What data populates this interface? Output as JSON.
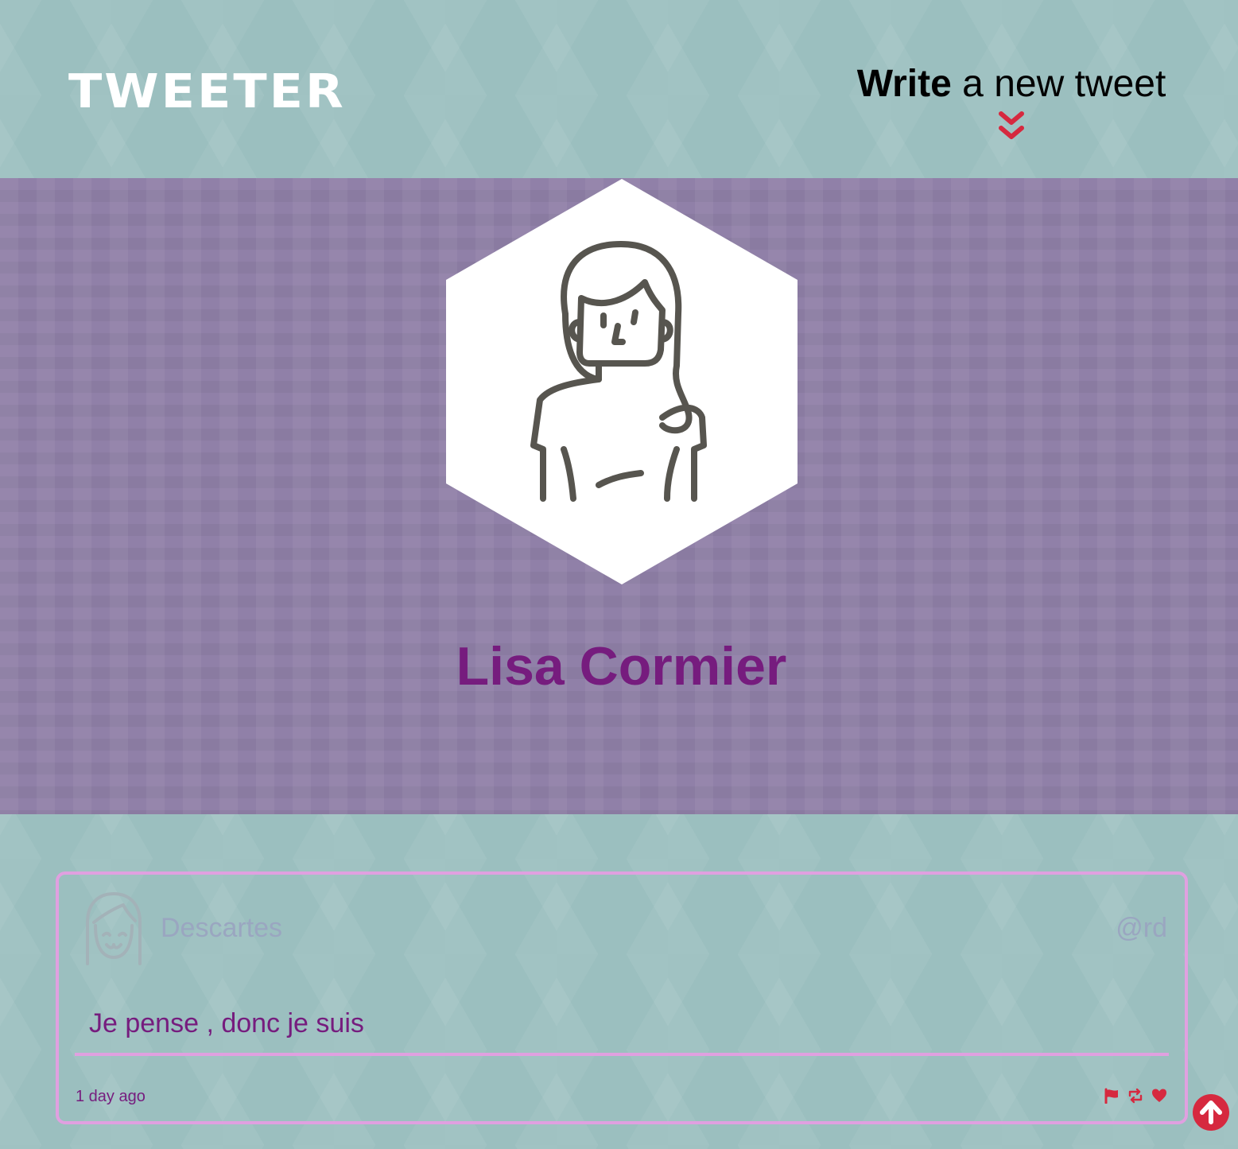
{
  "nav": {
    "brand": "TWEETER",
    "compose_bold": "Write",
    "compose_rest": " a new tweet",
    "compose_icon": "double-chevron-down-icon"
  },
  "profile": {
    "name": "Lisa Cormier",
    "avatar_icon": "woman-avatar-icon"
  },
  "tweets": [
    {
      "author": "Descartes",
      "handle": "@rd",
      "content": "Je pense , donc je suis",
      "time": "1 day ago",
      "avatar_icon": "smiling-face-avatar-icon",
      "actions": [
        "flag-icon",
        "retweet-icon",
        "heart-icon"
      ]
    }
  ],
  "scroll_top_icon": "arrow-up-circle-icon",
  "colors": {
    "accent": "#d6293f",
    "name_purple": "#761c7e",
    "card_border": "#e0a0e0",
    "teal_bg": "#9bbfbf",
    "purple_bg": "#9080a8"
  }
}
